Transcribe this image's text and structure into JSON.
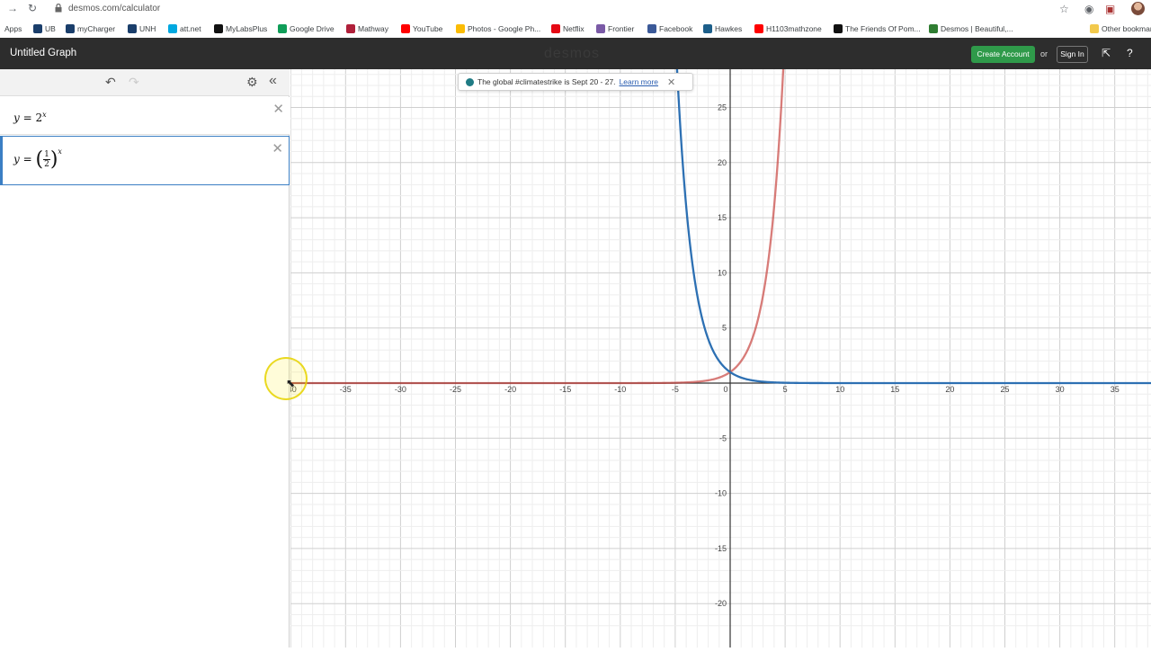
{
  "browser": {
    "url": "desmos.com/calculator",
    "bookmarks": [
      {
        "label": "Apps",
        "icon": "apps-grid-icon",
        "color": "#4285f4"
      },
      {
        "label": "UB",
        "icon": "ub-icon",
        "color": "#1a3e6b"
      },
      {
        "label": "myCharger",
        "icon": "mycharger-icon",
        "color": "#1a3e6b"
      },
      {
        "label": "UNH",
        "icon": "unh-icon",
        "color": "#1a3e6b"
      },
      {
        "label": "att.net",
        "icon": "att-icon",
        "color": "#00a8e0"
      },
      {
        "label": "MyLabsPlus",
        "icon": "mylabsplus-icon",
        "color": "#111111"
      },
      {
        "label": "Google Drive",
        "icon": "google-drive-icon",
        "color": "#0f9d58"
      },
      {
        "label": "Mathway",
        "icon": "mathway-icon",
        "color": "#b0203a"
      },
      {
        "label": "YouTube",
        "icon": "youtube-icon",
        "color": "#ff0000"
      },
      {
        "label": "Photos - Google Ph...",
        "icon": "google-photos-icon",
        "color": "#fbbc05"
      },
      {
        "label": "Netflix",
        "icon": "netflix-icon",
        "color": "#e50914"
      },
      {
        "label": "Frontier",
        "icon": "frontier-mail-icon",
        "color": "#7a5aa6"
      },
      {
        "label": "Facebook",
        "icon": "facebook-icon",
        "color": "#3b5998"
      },
      {
        "label": "Hawkes",
        "icon": "hawkes-icon",
        "color": "#1d5f8a"
      },
      {
        "label": "H1103mathzone",
        "icon": "youtube-icon",
        "color": "#ff0000"
      },
      {
        "label": "The Friends Of Pom...",
        "icon": "friends-icon",
        "color": "#111111"
      },
      {
        "label": "Desmos | Beautiful,...",
        "icon": "desmos-icon",
        "color": "#2f7d32"
      }
    ],
    "other_bookmarks": "Other bookmarks"
  },
  "header": {
    "title": "Untitled Graph",
    "brand": "desmos",
    "create_account": "Create Account",
    "or": "or",
    "sign_in": "Sign In"
  },
  "expressions": [
    {
      "id": 1,
      "lhs": "y",
      "base": "2",
      "exponent": "x",
      "color": "#c74440"
    },
    {
      "id": 2,
      "lhs": "y",
      "numerator": "1",
      "denominator": "2",
      "exponent": "x",
      "color": "#2d70b3",
      "selected": true
    }
  ],
  "notice": {
    "text": "The global #climatestrike is Sept 20 - 27.",
    "link": "Learn more"
  },
  "chart_data": {
    "type": "line",
    "xlim": [
      -40,
      38
    ],
    "ylim": [
      -22.5,
      29
    ],
    "grid": true,
    "x_tick_labels": [
      "-40",
      "-35",
      "-30",
      "-25",
      "-20",
      "-15",
      "-10",
      "-5",
      "0",
      "5",
      "10",
      "15",
      "20",
      "25",
      "30",
      "35"
    ],
    "y_tick_labels": [
      "25",
      "20",
      "15",
      "10",
      "5",
      "-5",
      "-10",
      "-15",
      "-20"
    ],
    "series": [
      {
        "formula": "2^x",
        "color": "#c74440",
        "base": 2
      },
      {
        "formula": "(1/2)^x",
        "color": "#2d70b3",
        "base": 0.5
      }
    ]
  }
}
